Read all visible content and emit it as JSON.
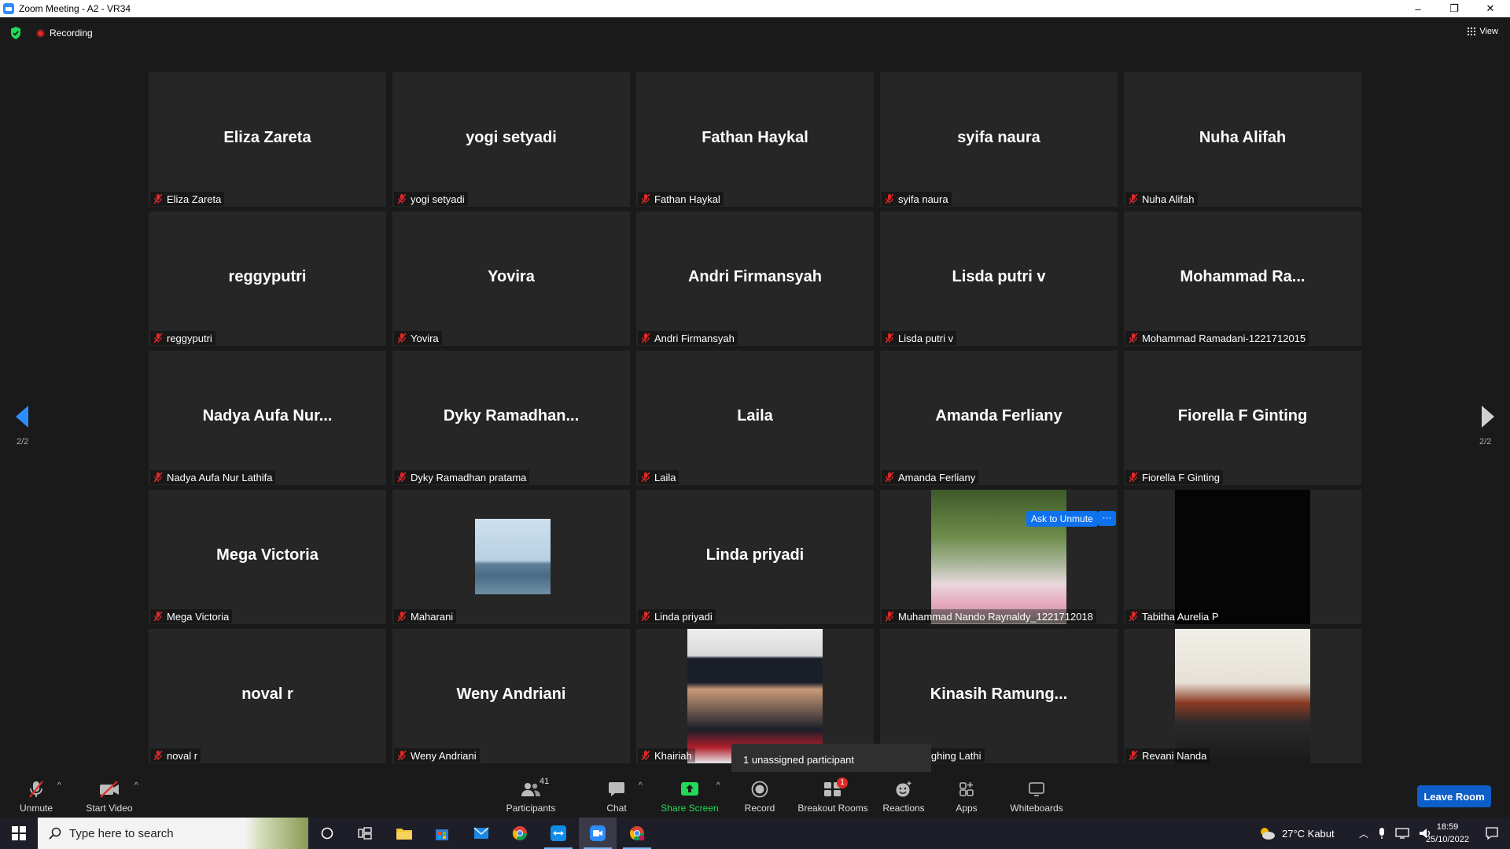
{
  "window": {
    "title": "Zoom Meeting - A2 - VR34",
    "minimize": "–",
    "restore": "❐",
    "close": "✕"
  },
  "topbar": {
    "recording_label": "Recording",
    "view_label": "View"
  },
  "gallery": {
    "page_indicator_left": "2/2",
    "page_indicator_right": "2/2",
    "tiles": [
      {
        "big": "Eliza Zareta",
        "label": "Eliza Zareta"
      },
      {
        "big": "yogi setyadi",
        "label": "yogi setyadi"
      },
      {
        "big": "Fathan Haykal",
        "label": "Fathan Haykal"
      },
      {
        "big": "syifa naura",
        "label": "syifa naura"
      },
      {
        "big": "Nuha Alifah",
        "label": "Nuha Alifah"
      },
      {
        "big": "reggyputri",
        "label": "reggyputri"
      },
      {
        "big": "Yovira",
        "label": "Yovira"
      },
      {
        "big": "Andri Firmansyah",
        "label": "Andri Firmansyah"
      },
      {
        "big": "Lisda putri v",
        "label": "Lisda putri v"
      },
      {
        "big": "Mohammad  Ra...",
        "label": "Mohammad Ramadani-1221712015"
      },
      {
        "big": "Nadya  Aufa  Nur...",
        "label": "Nadya Aufa Nur Lathifa"
      },
      {
        "big": "Dyky  Ramadhan...",
        "label": "Dyky Ramadhan pratama"
      },
      {
        "big": "Laila",
        "label": "Laila"
      },
      {
        "big": "Amanda Ferliany",
        "label": "Amanda Ferliany"
      },
      {
        "big": "Fiorella F Ginting",
        "label": "Fiorella F Ginting"
      },
      {
        "big": "Mega Victoria",
        "label": "Mega Victoria"
      },
      {
        "big": "",
        "label": "Maharani"
      },
      {
        "big": "Linda priyadi",
        "label": "Linda priyadi"
      },
      {
        "big": "",
        "label": "Muhammad Nando Raynaldy_1221712018"
      },
      {
        "big": "",
        "label": "Tabitha Aurelia P"
      },
      {
        "big": "noval r",
        "label": "noval r"
      },
      {
        "big": "Weny Andriani",
        "label": "Weny Andriani"
      },
      {
        "big": "",
        "label": "Khairiah"
      },
      {
        "big": "Kinasih  Ramung...",
        "label": "Ramunghing Lathi"
      },
      {
        "big": "",
        "label": "Revani Nanda"
      }
    ],
    "ask_to_unmute": "Ask to Unmute",
    "more": "···",
    "tooltip": "1 unassigned participant"
  },
  "toolbar": {
    "unmute": "Unmute",
    "start_video": "Start Video",
    "participants": "Participants",
    "participants_count": "41",
    "chat": "Chat",
    "share_screen": "Share Screen",
    "record": "Record",
    "breakout_rooms": "Breakout Rooms",
    "breakout_badge": "1",
    "reactions": "Reactions",
    "apps": "Apps",
    "whiteboards": "Whiteboards",
    "leave_room": "Leave Room",
    "share_color": "#23d959"
  },
  "taskbar": {
    "search_placeholder": "Type here to search",
    "weather": "27°C  Kabut",
    "time": "18:59",
    "date": "25/10/2022"
  }
}
